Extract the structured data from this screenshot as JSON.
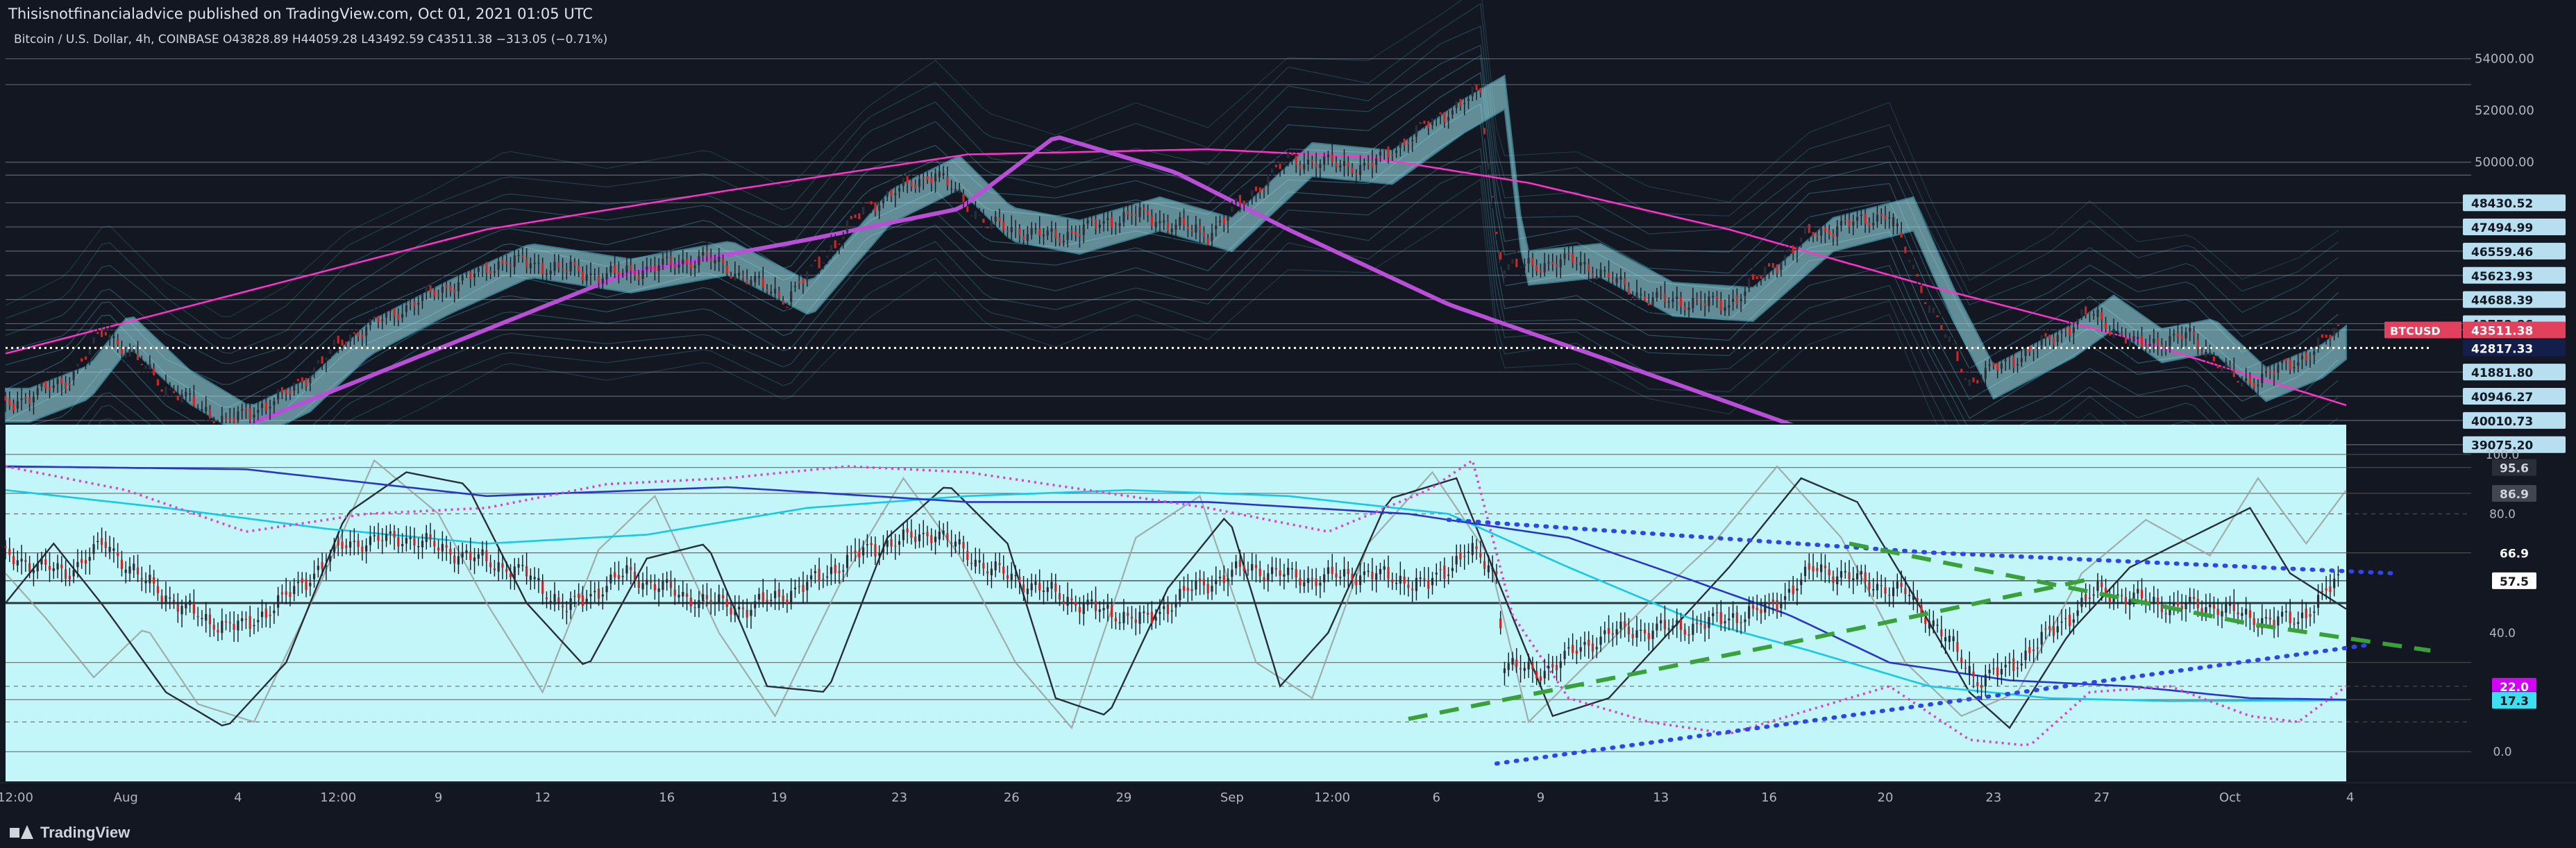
{
  "header": {
    "text": "Thisisnotfinancialadvice published on TradingView.com, Oct 01, 2021 01:05 UTC"
  },
  "symbol_line": "Bitcoin / U.S. Dollar, 4h, COINBASE  O43828.89  H44059.28  L43492.59  C43511.38  −313.05 (−0.71%)",
  "footer": {
    "brand": "TradingView"
  },
  "colors": {
    "background": "#131722",
    "oscillator_panel": "#c2f6f9",
    "candle_up": "#2a2e39",
    "candle_down": "#c62828",
    "arc_magenta": "#ff33cc",
    "trend_purple": "#b84fd6",
    "band_cyan": "#5ad3e6",
    "band_fill": "#a4ecf5",
    "dotted_blue": "#2f45e6",
    "dashed_green": "#3aa03a",
    "badge_btcusd": "#e2405c",
    "badge_dark": "#131f4a",
    "badge_blue": "#2ea8e6"
  },
  "chart_data": [
    {
      "type": "candlestick",
      "title": "Bitcoin / U.S. Dollar, 4h, COINBASE",
      "ylim": [
        39900,
        55200
      ],
      "y_ticks": [
        54000,
        52000,
        50000
      ],
      "x_ticks": [
        "12:00",
        "Aug",
        "4",
        "12:00",
        "9",
        "12",
        "16",
        "19",
        "23",
        "26",
        "29",
        "Sep",
        "12:00",
        "6",
        "9",
        "13",
        "16",
        "20",
        "23",
        "27",
        "Oct",
        "4"
      ],
      "x_tick_index": [
        0,
        30,
        58,
        83,
        108,
        134,
        165,
        193,
        223,
        251,
        279,
        306,
        331,
        357,
        383,
        413,
        440,
        469,
        496,
        523,
        555,
        585
      ],
      "last": 43511.38,
      "ohlc_last": {
        "o": 43828.89,
        "h": 44059.28,
        "l": 43492.59,
        "c": 43511.38
      },
      "keypoints": [
        [
          0,
          40600
        ],
        [
          15,
          41500
        ],
        [
          25,
          43500
        ],
        [
          40,
          41300
        ],
        [
          55,
          39900
        ],
        [
          70,
          41000
        ],
        [
          85,
          43200
        ],
        [
          105,
          44800
        ],
        [
          125,
          46200
        ],
        [
          150,
          45600
        ],
        [
          175,
          46300
        ],
        [
          195,
          44700
        ],
        [
          215,
          48300
        ],
        [
          232,
          49600
        ],
        [
          245,
          47600
        ],
        [
          262,
          47100
        ],
        [
          282,
          48000
        ],
        [
          300,
          47200
        ],
        [
          320,
          50100
        ],
        [
          340,
          49800
        ],
        [
          358,
          51800
        ],
        [
          368,
          52700
        ],
        [
          372,
          47300
        ],
        [
          374,
          45900
        ],
        [
          392,
          46200
        ],
        [
          410,
          44700
        ],
        [
          430,
          44500
        ],
        [
          450,
          47200
        ],
        [
          470,
          48000
        ],
        [
          480,
          44500
        ],
        [
          490,
          41500
        ],
        [
          510,
          43100
        ],
        [
          520,
          44200
        ],
        [
          532,
          42900
        ],
        [
          545,
          43300
        ],
        [
          558,
          41400
        ],
        [
          572,
          42300
        ],
        [
          582,
          43511
        ]
      ],
      "horizontal_levels": [
        54000,
        53000,
        50000,
        49500,
        48430.52,
        47494.99,
        46559.46,
        45623.93,
        44688.39,
        43752.86,
        43511.38,
        42817.33,
        41881.8,
        40946.27,
        40010.73,
        39075.2
      ],
      "price_labels": [
        {
          "value": 48430.52,
          "text": "48430.52",
          "style": "light"
        },
        {
          "value": 47494.99,
          "text": "47494.99",
          "style": "light"
        },
        {
          "value": 46559.46,
          "text": "46559.46",
          "style": "light"
        },
        {
          "value": 45623.93,
          "text": "45623.93",
          "style": "light"
        },
        {
          "value": 44688.39,
          "text": "44688.39",
          "style": "light"
        },
        {
          "value": 43752.86,
          "text": "43752.86",
          "style": "light"
        },
        {
          "value": 43511.38,
          "text": "43511.38",
          "style": "btc",
          "tag": "BTCUSD"
        },
        {
          "value": 42817.33,
          "text": "42817.33",
          "style": "dark"
        },
        {
          "value": 41881.8,
          "text": "41881.80",
          "style": "light"
        },
        {
          "value": 40946.27,
          "text": "40946.27",
          "style": "light"
        },
        {
          "value": 40010.73,
          "text": "40010.73",
          "style": "light"
        },
        {
          "value": 39075.2,
          "text": "39075.20",
          "style": "light"
        }
      ],
      "dotted_level": 42817.33,
      "arc_series": [
        [
          0,
          42600
        ],
        [
          60,
          45000
        ],
        [
          120,
          47400
        ],
        [
          180,
          48900
        ],
        [
          240,
          50300
        ],
        [
          300,
          50500
        ],
        [
          340,
          50200
        ],
        [
          380,
          49200
        ],
        [
          430,
          47400
        ],
        [
          480,
          45200
        ],
        [
          530,
          43200
        ],
        [
          584,
          40600
        ]
      ],
      "purple_trend": [
        [
          55,
          39500
        ],
        [
          155,
          45700
        ],
        [
          200,
          47000
        ],
        [
          238,
          48200
        ],
        [
          262,
          51000
        ],
        [
          292,
          49600
        ],
        [
          320,
          47400
        ],
        [
          360,
          44500
        ],
        [
          410,
          41800
        ],
        [
          450,
          39600
        ]
      ]
    },
    {
      "type": "oscillator",
      "ylim": [
        -10,
        110
      ],
      "y_ticks": [
        100.0,
        80.0,
        40.0,
        0.0
      ],
      "levels": [
        100.0,
        95.6,
        86.9,
        80.0,
        66.9,
        57.5,
        50.0,
        30.0,
        22.0,
        17.5,
        10.0,
        0.0
      ],
      "value_labels": [
        {
          "value": 95.6,
          "text": "95.6",
          "color": "#d1d4dc",
          "bg": "#2a2e39"
        },
        {
          "value": 86.9,
          "text": "86.9",
          "color": "#d1d4dc",
          "bg": "#434651"
        },
        {
          "value": 66.9,
          "text": "66.9",
          "color": "#ffffff",
          "bg": "#131722"
        },
        {
          "value": 57.5,
          "text": "57.5",
          "color": "#131722",
          "bg": "#ffffff"
        },
        {
          "value": 22.0,
          "text": "22.0",
          "color": "#ffffff",
          "bg": "#d500f9"
        },
        {
          "value": 17.5,
          "text": "17.5",
          "color": "#ffffff",
          "bg": "#1f2bd6"
        },
        {
          "value": 17.3,
          "text": "17.3",
          "color": "#131722",
          "bg": "#3de0f0"
        }
      ],
      "candle_keypoints": [
        [
          0,
          66
        ],
        [
          15,
          60
        ],
        [
          25,
          70
        ],
        [
          35,
          57
        ],
        [
          50,
          44
        ],
        [
          60,
          42
        ],
        [
          72,
          54
        ],
        [
          85,
          70
        ],
        [
          100,
          72
        ],
        [
          115,
          66
        ],
        [
          130,
          60
        ],
        [
          140,
          48
        ],
        [
          155,
          60
        ],
        [
          170,
          52
        ],
        [
          185,
          48
        ],
        [
          200,
          56
        ],
        [
          215,
          68
        ],
        [
          232,
          74
        ],
        [
          245,
          62
        ],
        [
          258,
          55
        ],
        [
          272,
          48
        ],
        [
          285,
          44
        ],
        [
          295,
          54
        ],
        [
          310,
          62
        ],
        [
          325,
          58
        ],
        [
          340,
          60
        ],
        [
          355,
          56
        ],
        [
          365,
          68
        ],
        [
          372,
          60
        ],
        [
          374,
          30
        ],
        [
          382,
          26
        ],
        [
          400,
          40
        ],
        [
          420,
          42
        ],
        [
          440,
          48
        ],
        [
          452,
          62
        ],
        [
          462,
          58
        ],
        [
          475,
          53
        ],
        [
          485,
          37
        ],
        [
          492,
          24
        ],
        [
          500,
          28
        ],
        [
          512,
          42
        ],
        [
          522,
          54
        ],
        [
          530,
          52
        ],
        [
          540,
          49
        ],
        [
          552,
          49
        ],
        [
          560,
          45
        ],
        [
          572,
          44
        ],
        [
          582,
          57.5
        ]
      ],
      "blue_line": [
        [
          0,
          96
        ],
        [
          60,
          95
        ],
        [
          120,
          86
        ],
        [
          180,
          89
        ],
        [
          240,
          84
        ],
        [
          300,
          84
        ],
        [
          350,
          80
        ],
        [
          390,
          72
        ],
        [
          420,
          58
        ],
        [
          445,
          46
        ],
        [
          470,
          30
        ],
        [
          500,
          24
        ],
        [
          530,
          22
        ],
        [
          560,
          18
        ],
        [
          584,
          17.5
        ]
      ],
      "cyan_line": [
        [
          0,
          88
        ],
        [
          40,
          82
        ],
        [
          80,
          75
        ],
        [
          120,
          70
        ],
        [
          160,
          73
        ],
        [
          200,
          82
        ],
        [
          240,
          86
        ],
        [
          280,
          88
        ],
        [
          320,
          86
        ],
        [
          360,
          80
        ],
        [
          390,
          62
        ],
        [
          420,
          45
        ],
        [
          450,
          34
        ],
        [
          480,
          22
        ],
        [
          510,
          18
        ],
        [
          540,
          17
        ],
        [
          584,
          17.3
        ]
      ],
      "black_osc": [
        [
          0,
          50
        ],
        [
          12,
          70
        ],
        [
          25,
          48
        ],
        [
          40,
          20
        ],
        [
          55,
          8
        ],
        [
          70,
          30
        ],
        [
          85,
          80
        ],
        [
          100,
          94
        ],
        [
          115,
          90
        ],
        [
          130,
          50
        ],
        [
          145,
          28
        ],
        [
          160,
          65
        ],
        [
          175,
          70
        ],
        [
          190,
          22
        ],
        [
          205,
          20
        ],
        [
          220,
          72
        ],
        [
          235,
          90
        ],
        [
          250,
          70
        ],
        [
          262,
          18
        ],
        [
          275,
          12
        ],
        [
          290,
          55
        ],
        [
          305,
          80
        ],
        [
          318,
          22
        ],
        [
          330,
          40
        ],
        [
          345,
          85
        ],
        [
          362,
          92
        ],
        [
          374,
          52
        ],
        [
          386,
          12
        ],
        [
          400,
          18
        ],
        [
          415,
          40
        ],
        [
          430,
          62
        ],
        [
          448,
          92
        ],
        [
          462,
          84
        ],
        [
          475,
          55
        ],
        [
          490,
          20
        ],
        [
          500,
          8
        ],
        [
          515,
          40
        ],
        [
          530,
          62
        ],
        [
          545,
          72
        ],
        [
          560,
          82
        ],
        [
          570,
          60
        ],
        [
          584,
          48
        ]
      ],
      "grey_osc": [
        [
          0,
          60
        ],
        [
          10,
          45
        ],
        [
          22,
          25
        ],
        [
          35,
          42
        ],
        [
          48,
          16
        ],
        [
          62,
          10
        ],
        [
          78,
          55
        ],
        [
          92,
          98
        ],
        [
          108,
          80
        ],
        [
          120,
          50
        ],
        [
          134,
          20
        ],
        [
          148,
          68
        ],
        [
          162,
          86
        ],
        [
          178,
          40
        ],
        [
          192,
          12
        ],
        [
          208,
          56
        ],
        [
          224,
          92
        ],
        [
          238,
          66
        ],
        [
          252,
          30
        ],
        [
          266,
          8
        ],
        [
          282,
          72
        ],
        [
          298,
          86
        ],
        [
          312,
          30
        ],
        [
          326,
          18
        ],
        [
          340,
          70
        ],
        [
          356,
          94
        ],
        [
          370,
          66
        ],
        [
          380,
          10
        ],
        [
          395,
          30
        ],
        [
          410,
          50
        ],
        [
          426,
          70
        ],
        [
          442,
          96
        ],
        [
          458,
          72
        ],
        [
          474,
          30
        ],
        [
          488,
          12
        ],
        [
          502,
          20
        ],
        [
          518,
          60
        ],
        [
          534,
          78
        ],
        [
          550,
          66
        ],
        [
          562,
          92
        ],
        [
          574,
          70
        ],
        [
          584,
          88
        ]
      ],
      "pink_dotted": [
        [
          0,
          96
        ],
        [
          30,
          88
        ],
        [
          60,
          74
        ],
        [
          90,
          80
        ],
        [
          120,
          82
        ],
        [
          150,
          90
        ],
        [
          180,
          92
        ],
        [
          210,
          96
        ],
        [
          240,
          94
        ],
        [
          270,
          88
        ],
        [
          300,
          82
        ],
        [
          330,
          74
        ],
        [
          355,
          88
        ],
        [
          366,
          98
        ],
        [
          376,
          46
        ],
        [
          390,
          18
        ],
        [
          410,
          10
        ],
        [
          430,
          6
        ],
        [
          450,
          14
        ],
        [
          470,
          22
        ],
        [
          490,
          4
        ],
        [
          505,
          2
        ],
        [
          520,
          20
        ],
        [
          540,
          22
        ],
        [
          560,
          12
        ],
        [
          572,
          10
        ],
        [
          584,
          22
        ]
      ],
      "dotted_top": [
        [
          360,
          78
        ],
        [
          480,
          67
        ],
        [
          596,
          60
        ]
      ],
      "dotted_bottom": [
        [
          372,
          -4
        ],
        [
          470,
          14
        ],
        [
          590,
          36
        ]
      ],
      "dashed_green": [
        [
          350,
          11
        ],
        [
          450,
          38
        ],
        [
          520,
          58
        ]
      ],
      "dashed_green2": [
        [
          460,
          70
        ],
        [
          560,
          43
        ],
        [
          605,
          34
        ]
      ]
    }
  ]
}
